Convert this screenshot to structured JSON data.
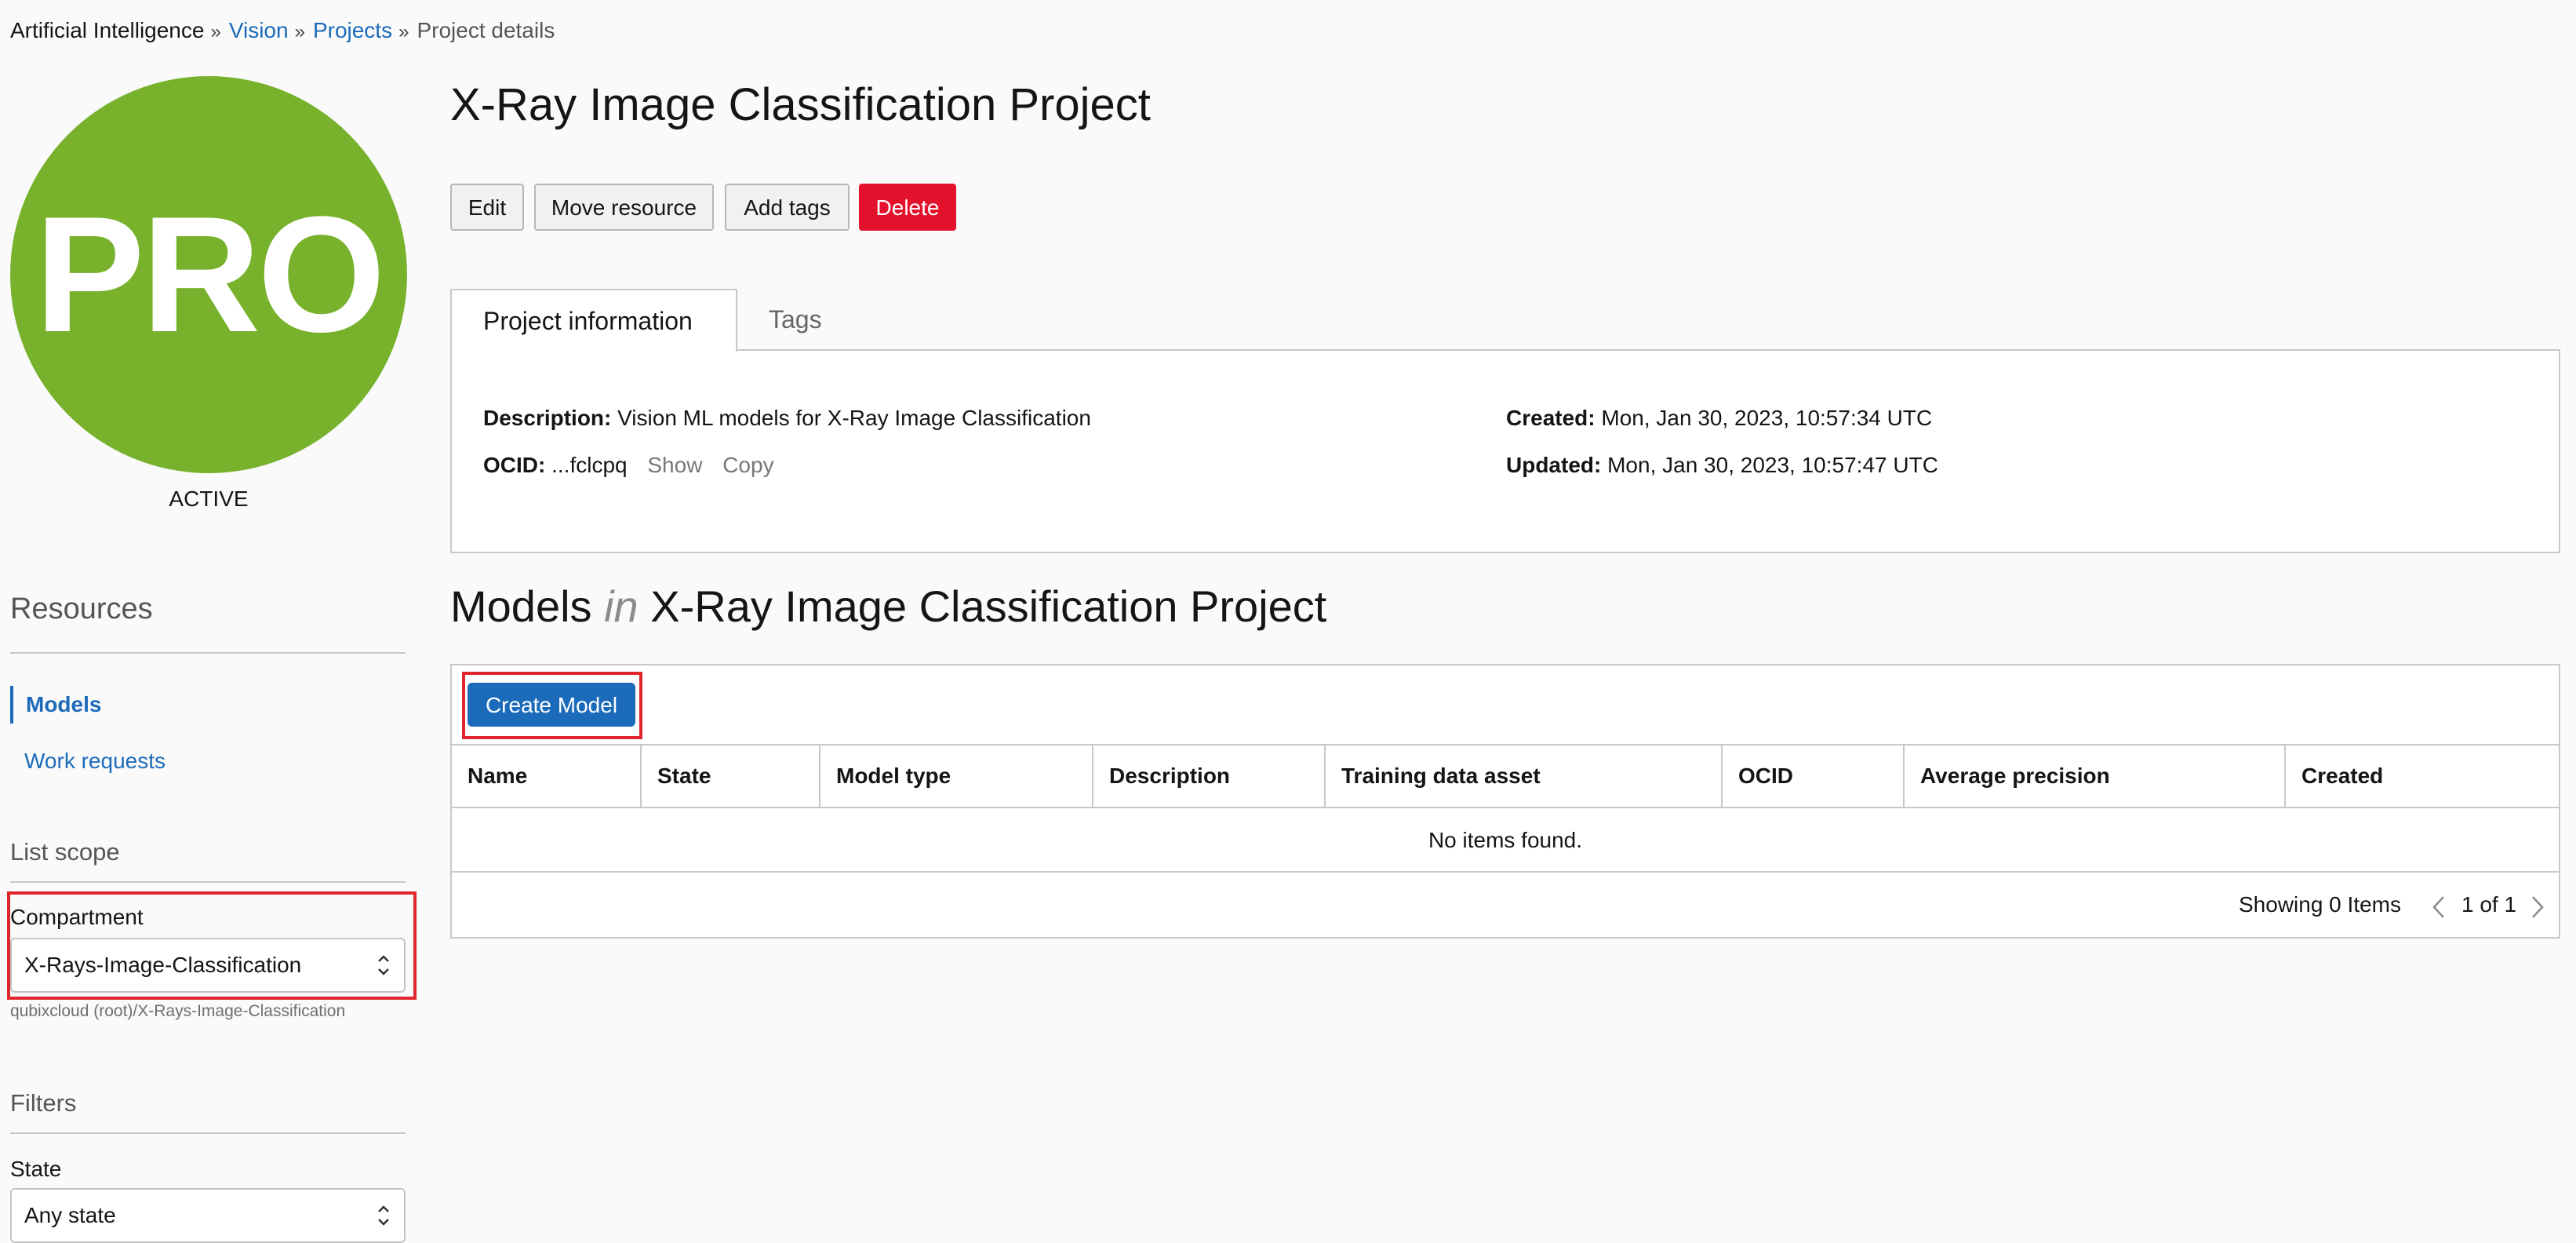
{
  "breadcrumb": {
    "root": "Artificial Intelligence",
    "vision": "Vision",
    "projects": "Projects",
    "current": "Project details",
    "separator": "»"
  },
  "avatar": {
    "initials": "PRO",
    "color": "#78b22d"
  },
  "status": "ACTIVE",
  "sidebar": {
    "resources_title": "Resources",
    "items": [
      {
        "label": "Models",
        "active": true
      },
      {
        "label": "Work requests",
        "active": false
      }
    ],
    "list_scope_title": "List scope",
    "compartment_label": "Compartment",
    "compartment_value": "X-Rays-Image-Classification",
    "compartment_path": "qubixcloud (root)/X-Rays-Image-Classification",
    "filters_title": "Filters",
    "state_label": "State",
    "state_value": "Any state"
  },
  "page_title": "X-Ray Image Classification Project",
  "actions": {
    "edit": "Edit",
    "move": "Move resource",
    "tags": "Add tags",
    "delete": "Delete"
  },
  "tabs": {
    "info": "Project information",
    "tags": "Tags"
  },
  "info": {
    "description_label": "Description:",
    "description_value": "Vision ML models for X-Ray Image Classification",
    "ocid_label": "OCID:",
    "ocid_value": "...fclcpq",
    "show": "Show",
    "copy": "Copy",
    "created_label": "Created:",
    "created_value": "Mon, Jan 30, 2023, 10:57:34 UTC",
    "updated_label": "Updated:",
    "updated_value": "Mon, Jan 30, 2023, 10:57:47 UTC"
  },
  "models_section": {
    "title_prefix": "Models",
    "title_in": "in",
    "title_suffix": "X-Ray Image Classification Project",
    "create_button": "Create Model",
    "columns": [
      "Name",
      "State",
      "Model type",
      "Description",
      "Training data asset",
      "OCID",
      "Average precision",
      "Created"
    ],
    "empty_message": "No items found.",
    "showing": "Showing 0 Items",
    "page": "1 of 1"
  },
  "colors": {
    "link": "#1b6bba",
    "danger": "#e3112b",
    "highlight": "#e0262c"
  }
}
